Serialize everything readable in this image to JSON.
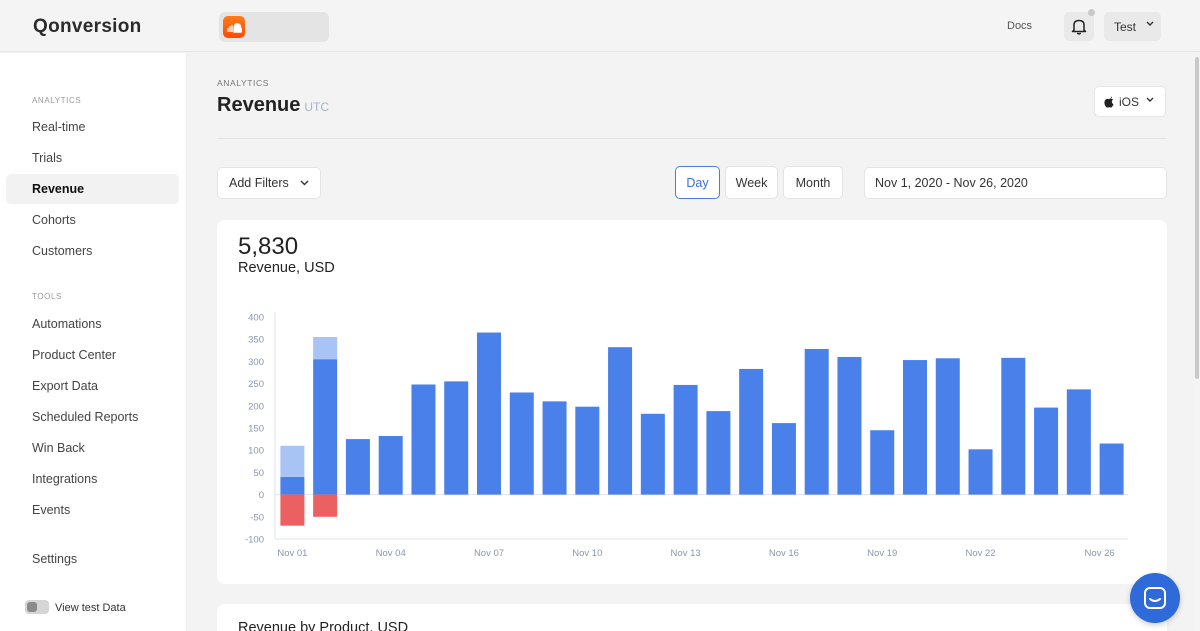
{
  "brand": {
    "name": "Qonversion",
    "app_icon": "cloud-app-icon",
    "accent_color": "#4a7de0"
  },
  "header": {
    "docs_label": "Docs",
    "bell_icon": "bell-icon",
    "user_label": "Test"
  },
  "sidebar": {
    "analytics_title": "ANALYTICS",
    "analytics_items": [
      {
        "label": "Real-time"
      },
      {
        "label": "Trials"
      },
      {
        "label": "Revenue"
      },
      {
        "label": "Cohorts"
      },
      {
        "label": "Customers"
      }
    ],
    "active_item": "Revenue",
    "tools_title": "TOOLS",
    "tools_items": [
      {
        "label": "Automations"
      },
      {
        "label": "Product Center"
      },
      {
        "label": "Export Data"
      },
      {
        "label": "Scheduled Reports"
      },
      {
        "label": "Win Back"
      },
      {
        "label": "Integrations"
      },
      {
        "label": "Events"
      }
    ],
    "settings_label": "Settings",
    "test_data_label": "View test Data",
    "test_data_on": false
  },
  "page": {
    "breadcrumb": "ANALYTICS",
    "title": "Revenue",
    "subtitle": "UTC",
    "platform_label": "iOS",
    "platform_icon": "apple-icon"
  },
  "filters": {
    "add_filters_label": "Add Filters",
    "granularity": [
      {
        "label": "Day"
      },
      {
        "label": "Week"
      },
      {
        "label": "Month"
      }
    ],
    "selected_granularity": "Day",
    "date_range": "Nov 1, 2020 - Nov 26, 2020"
  },
  "summary": {
    "value": "5,830",
    "label": "Revenue, USD"
  },
  "chart_data": {
    "type": "bar",
    "stacked": true,
    "categories": [
      "Nov 01",
      "Nov 02",
      "Nov 03",
      "Nov 04",
      "Nov 05",
      "Nov 06",
      "Nov 07",
      "Nov 08",
      "Nov 09",
      "Nov 10",
      "Nov 11",
      "Nov 12",
      "Nov 13",
      "Nov 14",
      "Nov 15",
      "Nov 16",
      "Nov 17",
      "Nov 18",
      "Nov 19",
      "Nov 20",
      "Nov 21",
      "Nov 22",
      "Nov 23",
      "Nov 24",
      "Nov 25",
      "Nov 26"
    ],
    "x_tick_labels": [
      "Nov 01",
      "Nov 04",
      "Nov 07",
      "Nov 10",
      "Nov 13",
      "Nov 16",
      "Nov 19",
      "Nov 22",
      "Nov 26"
    ],
    "y_ticks": [
      400,
      350,
      300,
      250,
      200,
      150,
      100,
      50,
      0,
      -50,
      -100
    ],
    "ylim": [
      -100,
      400
    ],
    "series": [
      {
        "color": "#4a80ea",
        "values": [
          40,
          305,
          125,
          132,
          248,
          255,
          365,
          230,
          210,
          198,
          332,
          182,
          247,
          188,
          283,
          161,
          328,
          310,
          145,
          303,
          307,
          102,
          308,
          196,
          237,
          115
        ]
      },
      {
        "color": "#a8c4f5",
        "values": [
          70,
          50,
          0,
          0,
          0,
          0,
          0,
          0,
          0,
          0,
          0,
          0,
          0,
          0,
          0,
          0,
          0,
          0,
          0,
          0,
          0,
          0,
          0,
          0,
          0,
          0
        ]
      },
      {
        "color": "#eb6060",
        "values": [
          -70,
          -50,
          0,
          0,
          0,
          0,
          0,
          0,
          0,
          0,
          0,
          0,
          0,
          0,
          0,
          0,
          0,
          0,
          0,
          0,
          0,
          0,
          0,
          0,
          0,
          0
        ]
      }
    ],
    "grid": false,
    "legend": "none"
  },
  "second_card": {
    "title": "Revenue by Product, USD"
  },
  "chat": {
    "icon": "chat-icon"
  }
}
